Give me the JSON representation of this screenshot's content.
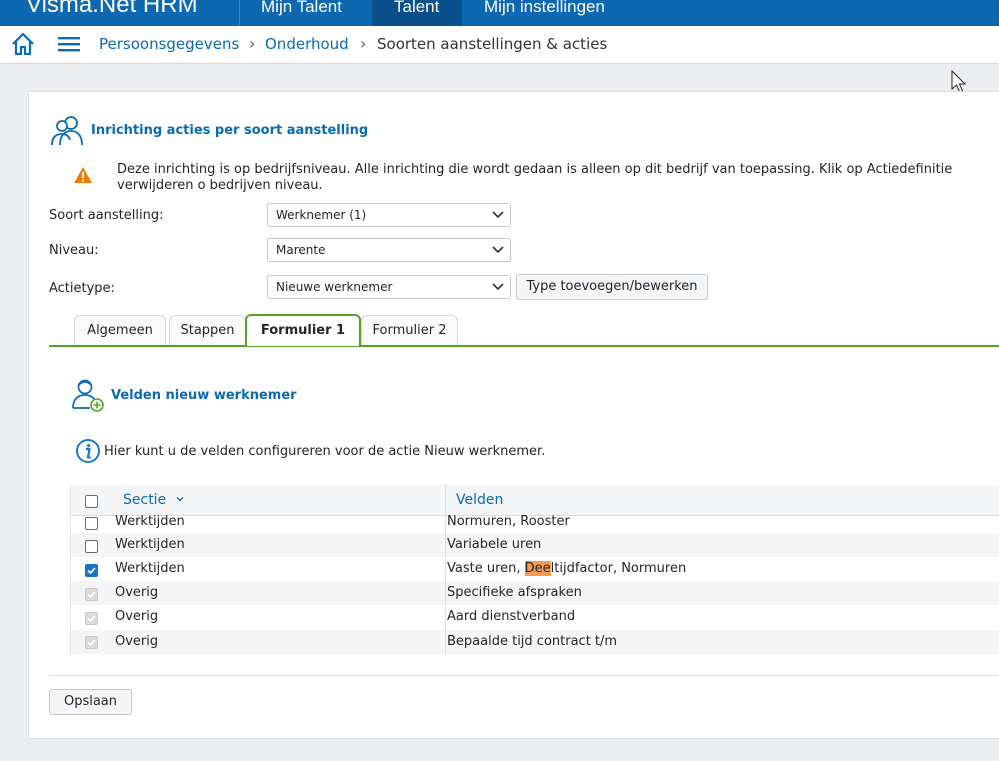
{
  "topbar": {
    "brand": "Visma.Net HRM",
    "nav": [
      "Mijn Talent",
      "Talent",
      "Mijn instellingen"
    ],
    "active": "Talent"
  },
  "breadcrumb": {
    "items": [
      "Persoonsgegevens",
      "Onderhoud",
      "Soorten aanstellingen & acties"
    ]
  },
  "section": {
    "title": "Inrichting acties per soort aanstelling",
    "warning": "Deze inrichting is op bedrijfsniveau. Alle inrichting die wordt gedaan is alleen op dit bedrijf van toepassing. Klik op Actiedefinitie verwijderen o bedrijven niveau."
  },
  "form": {
    "soort_label": "Soort aanstelling:",
    "soort_value": "Werknemer (1)",
    "niveau_label": "Niveau:",
    "niveau_value": "Marente",
    "actietype_label": "Actietype:",
    "actietype_value": "Nieuwe werknemer",
    "type_button": "Type toevoegen/bewerken"
  },
  "tabs": [
    "Algemeen",
    "Stappen",
    "Formulier 1",
    "Formulier 2"
  ],
  "active_tab": "Formulier 1",
  "subsection": {
    "title": "Velden nieuw werknemer",
    "info": "Hier kunt u de velden configureren voor de actie Nieuw werknemer."
  },
  "grid": {
    "headers": [
      "Sectie",
      "Velden"
    ],
    "rows": [
      {
        "sectie": "Werktijden",
        "velden": "Normuren, Rooster",
        "checked": false,
        "disabled": false
      },
      {
        "sectie": "Werktijden",
        "velden": "Variabele uren",
        "checked": false,
        "disabled": false
      },
      {
        "sectie": "Werktijden",
        "velden_pre": "Vaste uren, ",
        "velden_hl": "Dee",
        "velden_post": "ltijdfactor, Normuren",
        "checked": true,
        "disabled": false
      },
      {
        "sectie": "Overig",
        "velden": "Specifieke afspraken",
        "checked": true,
        "disabled": true
      },
      {
        "sectie": "Overig",
        "velden": "Aard dienstverband",
        "checked": true,
        "disabled": true
      },
      {
        "sectie": "Overig",
        "velden": "Bepaalde tijd contract t/m",
        "checked": true,
        "disabled": true
      }
    ]
  },
  "save_button": "Opslaan",
  "colors": {
    "brand_blue": "#0b68b1",
    "active_nav": "#0a4f8a",
    "tab_green": "#56a12c",
    "link_blue": "#0a6ab2",
    "warning_orange": "#f07c00",
    "highlight": "#f79c4a"
  }
}
